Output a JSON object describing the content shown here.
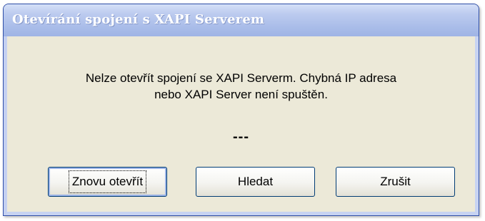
{
  "dialog": {
    "title": "Otevírání spojení s XAPI Serverem",
    "message_line1": "Nelze otevřít spojení se XAPI Serverm. Chybná IP adresa",
    "message_line2": "nebo XAPI Server není spuštěn.",
    "status": "---"
  },
  "buttons": {
    "reopen_label": "Znovu otevřít",
    "search_label": "Hledat",
    "cancel_label": "Zrušit"
  },
  "colors": {
    "titlebar": "#a6bae8",
    "client_background": "#ece9d8",
    "button_border": "#003c74"
  }
}
